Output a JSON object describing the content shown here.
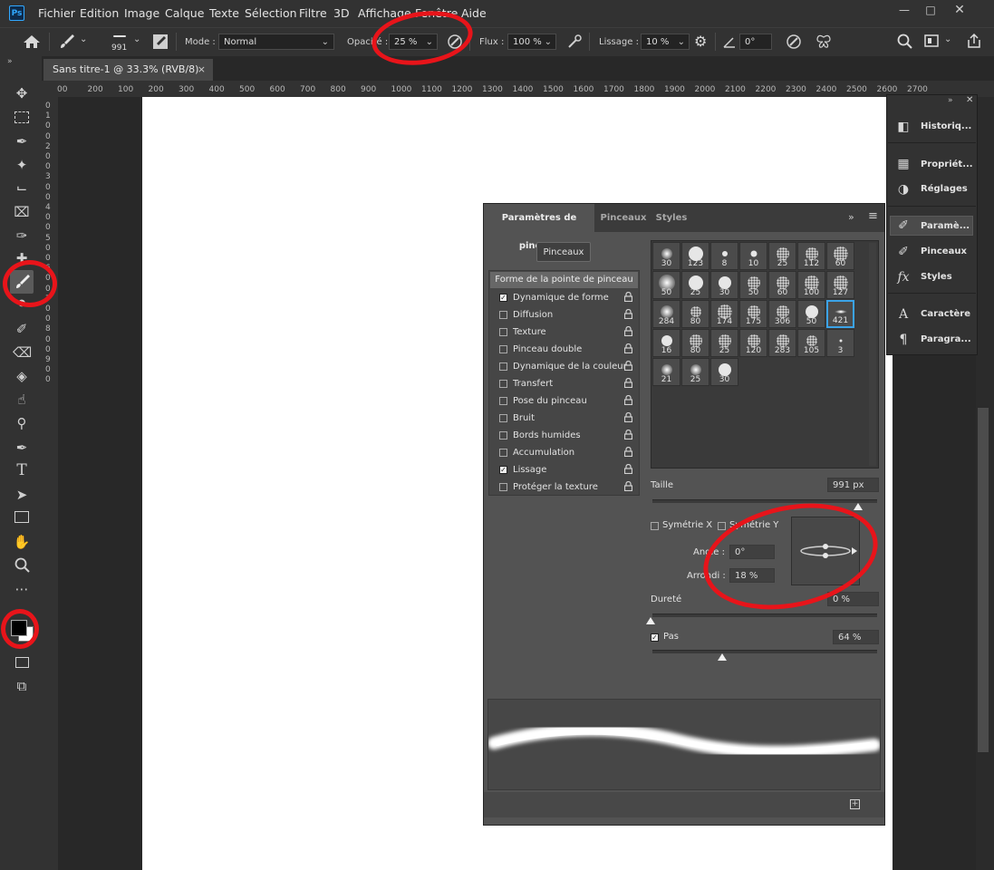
{
  "menubar": {
    "logo": "Ps",
    "items": [
      "Fichier",
      "Edition",
      "Image",
      "Calque",
      "Texte",
      "Sélection",
      "Filtre",
      "3D",
      "Affichage",
      "Fenêtre",
      "Aide"
    ]
  },
  "optionsbar": {
    "brush_size": "991",
    "mode_label": "Mode :",
    "mode_value": "Normal",
    "opacity_label": "Opacité :",
    "opacity_value": "25 %",
    "flow_label": "Flux :",
    "flow_value": "100 %",
    "smoothing_label": "Lissage :",
    "smoothing_value": "10 %",
    "angle_value": "0°"
  },
  "document": {
    "tab_title": "Sans titre-1 @ 33.3% (RVB/8)",
    "close_glyph": "×"
  },
  "ruler": {
    "h_labels": [
      "00",
      "200",
      "100",
      "200",
      "300",
      "400",
      "500",
      "600",
      "700",
      "800",
      "900",
      "1000",
      "1100",
      "1200",
      "1300",
      "1400",
      "1500",
      "1600",
      "1700",
      "1800",
      "1900",
      "2000",
      "2100",
      "2200",
      "2300",
      "2400",
      "2500",
      "2600",
      "2700"
    ],
    "v_labels": [
      "0",
      "1",
      "0",
      "0",
      "2",
      "0",
      "0",
      "3",
      "0",
      "0",
      "4",
      "0",
      "0",
      "5",
      "0",
      "0",
      "6",
      "0",
      "0",
      "7",
      "0",
      "0",
      "8",
      "0",
      "0",
      "9",
      "0",
      "0"
    ]
  },
  "dock": {
    "items": [
      {
        "label": "Historiq...",
        "icon": "history-icon"
      },
      {
        "label": "Propriét...",
        "icon": "properties-icon"
      },
      {
        "label": "Réglages",
        "icon": "adjustments-icon"
      },
      {
        "label": "Paramè...",
        "icon": "brush-settings-icon"
      },
      {
        "label": "Pinceaux",
        "icon": "brushes-icon"
      },
      {
        "label": "Styles",
        "icon": "styles-icon"
      },
      {
        "label": "Caractère",
        "icon": "character-icon"
      },
      {
        "label": "Paragra...",
        "icon": "paragraph-icon"
      }
    ]
  },
  "brushpanel": {
    "tabs": [
      "Paramètres de pinceau",
      "Pinceaux",
      "Styles"
    ],
    "pinceaux_button": "Pinceaux",
    "list_header": "Forme de la pointe de pinceau",
    "list": [
      {
        "label": "Dynamique de forme",
        "checked": true
      },
      {
        "label": "Diffusion",
        "checked": false
      },
      {
        "label": "Texture",
        "checked": false
      },
      {
        "label": "Pinceau double",
        "checked": false
      },
      {
        "label": "Dynamique de la couleur",
        "checked": false
      },
      {
        "label": "Transfert",
        "checked": false
      },
      {
        "label": "Pose du pinceau",
        "checked": false
      },
      {
        "label": "Bruit",
        "checked": false
      },
      {
        "label": "Bords humides",
        "checked": false
      },
      {
        "label": "Accumulation",
        "checked": false
      },
      {
        "label": "Lissage",
        "checked": true
      },
      {
        "label": "Protéger la texture",
        "checked": false
      }
    ],
    "brush_numbers": [
      "30",
      "123",
      "8",
      "10",
      "25",
      "112",
      "60",
      "50",
      "25",
      "30",
      "50",
      "60",
      "100",
      "127",
      "284",
      "80",
      "174",
      "175",
      "306",
      "50",
      "421",
      "16",
      "80",
      "25",
      "120",
      "283",
      "105",
      "3",
      "21",
      "25",
      "30"
    ],
    "selected_brush": "421",
    "size_label": "Taille",
    "size_value": "991 px",
    "sym_x_label": "Symétrie X",
    "sym_y_label": "Symétrie Y",
    "angle_label": "Angle :",
    "angle_value": "0°",
    "roundness_label": "Arrondi :",
    "roundness_value": "18 %",
    "hardness_label": "Dureté",
    "hardness_value": "0 %",
    "spacing_label": "Pas",
    "spacing_value": "64 %",
    "spacing_checked": true
  },
  "annotations": {
    "color": "#e8141a"
  }
}
